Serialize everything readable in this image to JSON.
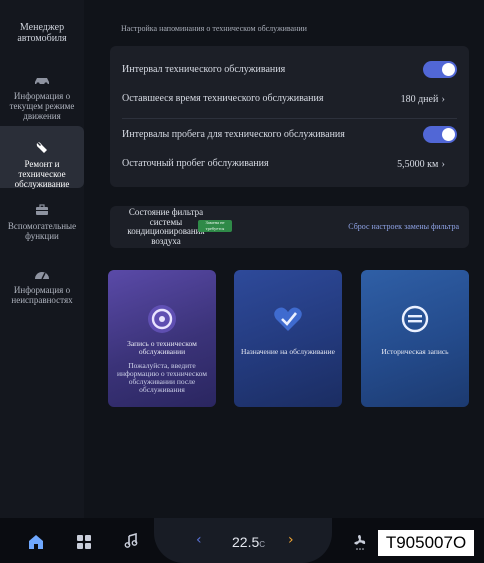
{
  "sidebar": {
    "title": "Менеджер автомобиля",
    "items": [
      {
        "label": "Информация о текущем режиме движения",
        "icon": "car-icon"
      },
      {
        "label": "Ремонт и техническое обслуживание",
        "icon": "wrench-icon"
      },
      {
        "label": "Вспомогательные функции",
        "icon": "toolbox-icon"
      },
      {
        "label": "Информация о неисправностях",
        "icon": "gauge-icon"
      }
    ]
  },
  "header": {
    "title": "Настройка напоминания о техническом обслуживании"
  },
  "service": {
    "interval_label": "Интервал технического обслуживания",
    "interval_on": true,
    "remaining_time_label": "Оставшееся время технического обслуживания",
    "remaining_time_value": "180 дней",
    "mileage_intervals_label": "Интервалы пробега для технического обслуживания",
    "mileage_on": true,
    "remaining_mileage_label": "Остаточный пробег обслуживания",
    "remaining_mileage_value": "5,5000 км"
  },
  "filter": {
    "title": "Состояние фильтра системы кондиционирования воздуха",
    "badge": "Замена не требуется",
    "reset": "Сброс настроек замены фильтра"
  },
  "tiles": [
    {
      "label": "Запись о техническом обслуживании",
      "sub": "Пожалуйста, введите информацию о техническом обслуживании после обслуживания",
      "icon": "disc-record-icon"
    },
    {
      "label": "Назначение на обслуживание",
      "icon": "heart-check-icon"
    },
    {
      "label": "Историческая запись",
      "icon": "history-icon"
    }
  ],
  "bottom": {
    "temperature": "22.5",
    "temp_unit": "C",
    "code": "T905007O"
  },
  "colors": {
    "accent": "#5167d6",
    "badge": "#2f8a48"
  }
}
